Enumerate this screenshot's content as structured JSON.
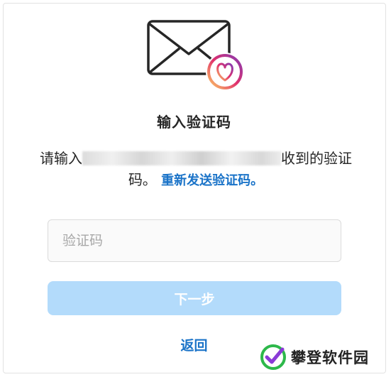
{
  "dialog": {
    "heading": "输入验证码",
    "description_prefix": "请输入",
    "description_suffix": "收到的验证码。",
    "resend_link": "重新发送验证码。",
    "code_input": {
      "value": "",
      "placeholder": "验证码"
    },
    "next_button": "下一步",
    "back_link": "返回"
  },
  "watermark": {
    "text": "攀登软件园"
  },
  "colors": {
    "link": "#1a73c8",
    "button_disabled": "#b3dbfb",
    "heart_gradient_start": "#fccc63",
    "heart_gradient_mid": "#e1306c",
    "heart_gradient_end": "#833ab4"
  },
  "icons": {
    "envelope": "envelope-icon",
    "heart": "heart-badge-icon",
    "watermark_logo": "checkmark-logo-icon"
  }
}
